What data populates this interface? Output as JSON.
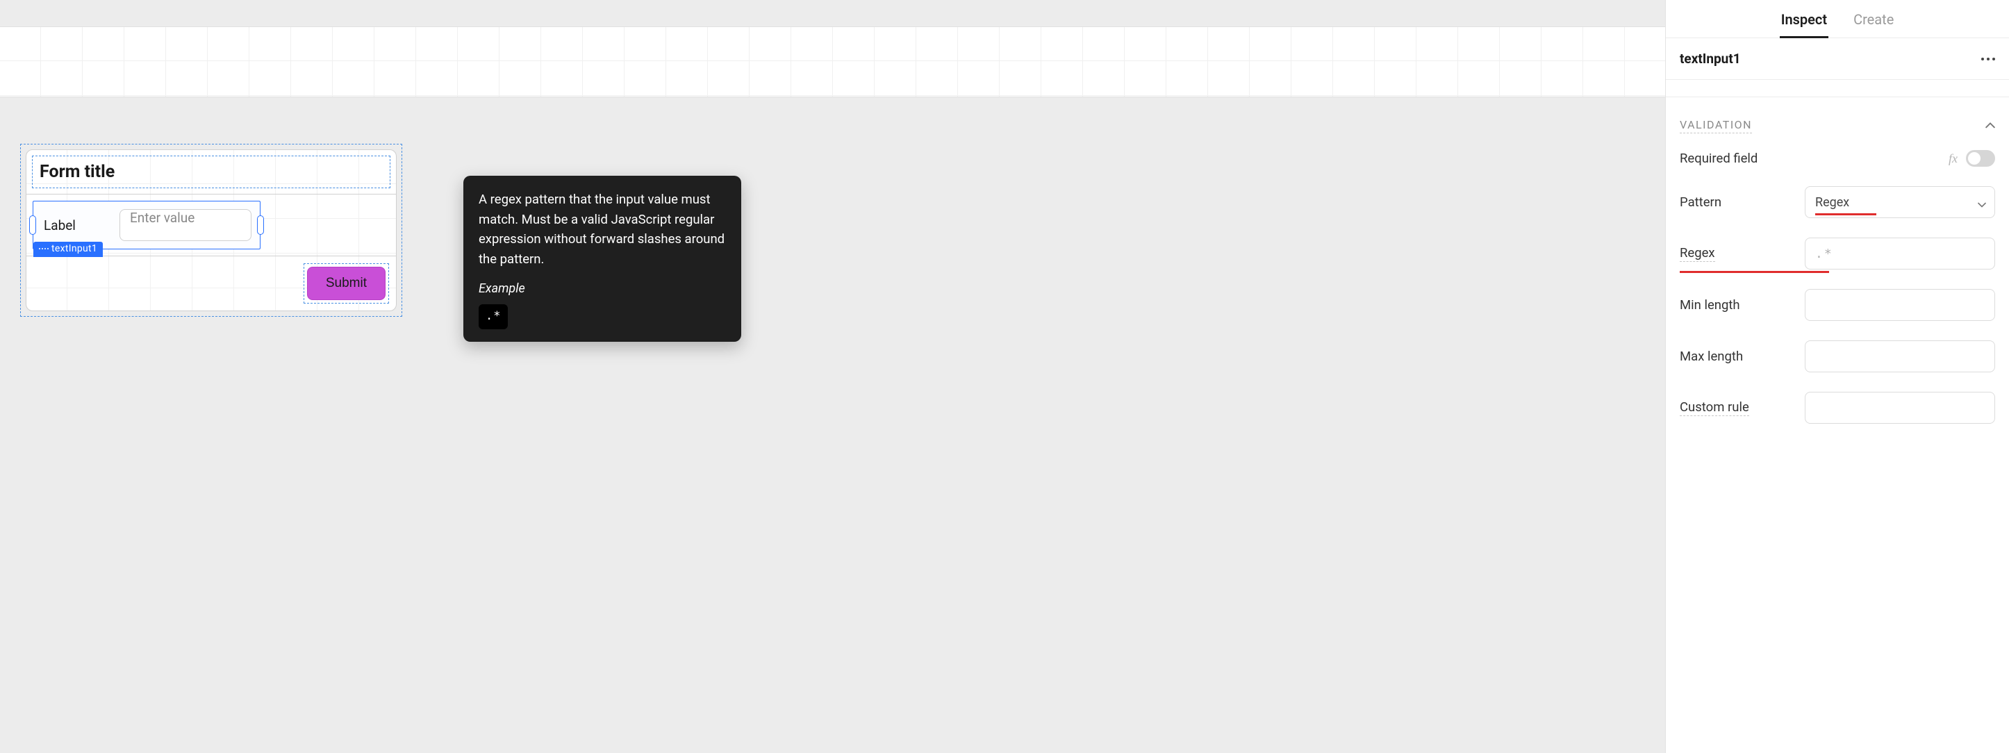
{
  "canvas": {
    "form": {
      "title": "Form title",
      "input_label": "Label",
      "input_placeholder": "Enter value",
      "selection_tag": "textInput1",
      "submit_label": "Submit"
    }
  },
  "tooltip": {
    "body": "A regex pattern that the input value must match. Must be a valid JavaScript regular expression without forward slashes around the pattern.",
    "example_label": "Example",
    "example_code": ".*"
  },
  "inspector": {
    "tabs": {
      "inspect": "Inspect",
      "create": "Create"
    },
    "component_name": "textInput1",
    "section_title": "VALIDATION",
    "fx_label": "fx",
    "props": {
      "required_field": "Required field",
      "pattern": "Pattern",
      "pattern_value": "Regex",
      "regex": "Regex",
      "regex_placeholder": ".*",
      "min_length": "Min length",
      "max_length": "Max length",
      "custom_rule": "Custom rule"
    }
  }
}
